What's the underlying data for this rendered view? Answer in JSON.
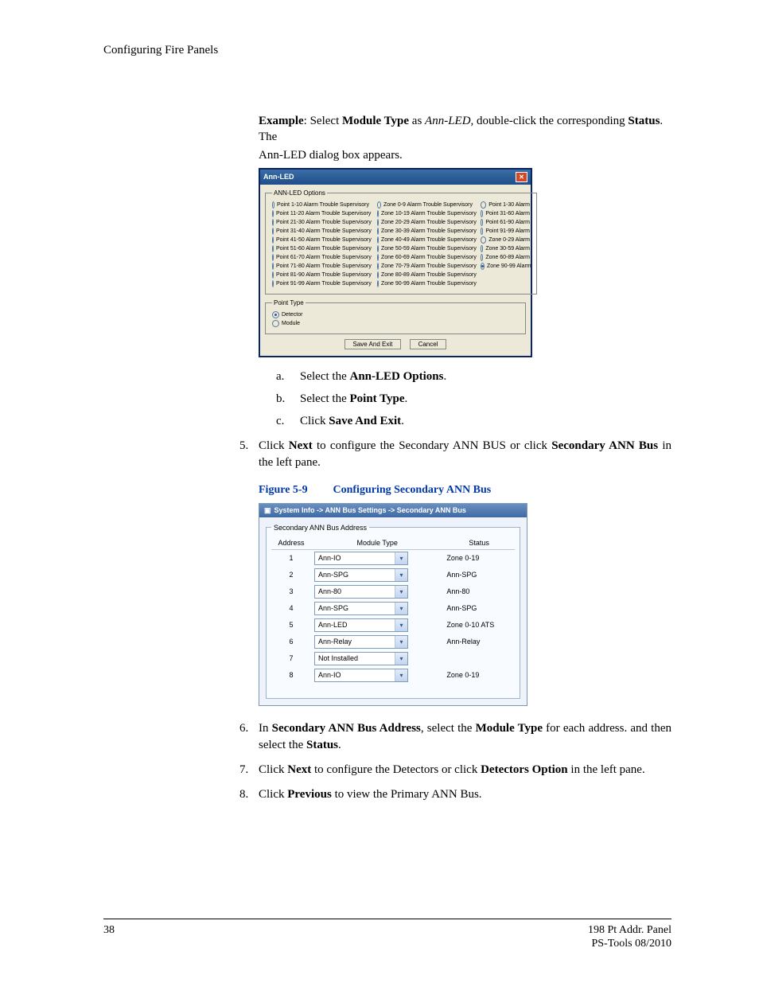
{
  "header": {
    "running": "Configuring Fire Panels"
  },
  "intro": {
    "pieces": [
      "Example",
      ": Select ",
      "Module Type",
      " as ",
      "Ann-LED,",
      " double-click the corresponding ",
      "Status",
      ". The"
    ],
    "line2": "Ann-LED dialog box appears."
  },
  "dialog": {
    "title": "Ann-LED",
    "options_legend": "ANN-LED Options",
    "col1": [
      "Point 1-10 Alarm Trouble Supervisory",
      "Point 11-20 Alarm Trouble Supervisory",
      "Point 21-30 Alarm Trouble Supervisory",
      "Point 31-40 Alarm Trouble Supervisory",
      "Point 41-50 Alarm Trouble Supervisory",
      "Point 51-60 Alarm Trouble Supervisory",
      "Point 61-70 Alarm Trouble Supervisory",
      "Point 71-80 Alarm Trouble Supervisory",
      "Point 81-90 Alarm Trouble Supervisory",
      "Point 91-99 Alarm Trouble Supervisory"
    ],
    "col2": [
      "Zone 0-9 Alarm Trouble Supervisory",
      "Zone 10-19 Alarm Trouble Supervisory",
      "Zone 20-29 Alarm Trouble Supervisory",
      "Zone 30-39 Alarm Trouble Supervisory",
      "Zone 40-49 Alarm Trouble Supervisory",
      "Zone 50-59 Alarm Trouble Supervisory",
      "Zone 60-69 Alarm Trouble Supervisory",
      "Zone 70-79 Alarm Trouble Supervisory",
      "Zone 80-89 Alarm Trouble Supervisory",
      "Zone 90-99 Alarm Trouble Supervisory"
    ],
    "col3": [
      "Point 1-30 Alarm",
      "Point 31-60 Alarm",
      "Point 61-90 Alarm",
      "Point 91-99 Alarm",
      "Zone 0-29 Alarm",
      "Zone 30-59 Alarm",
      "Zone 60-89 Alarm",
      "Zone 90-99 Alarm"
    ],
    "col3_selected_index": 7,
    "point_type_legend": "Point Type",
    "point_type": {
      "detector": "Detector",
      "module": "Module",
      "detector_selected": true
    },
    "save_btn": "Save And Exit",
    "cancel_btn": "Cancel"
  },
  "substeps": [
    {
      "m": "a.",
      "pre": "Select the ",
      "bold": "Ann-LED Options",
      "post": "."
    },
    {
      "m": "b.",
      "pre": "Select the ",
      "bold": "Point Type",
      "post": "."
    },
    {
      "m": "c.",
      "pre": "Click ",
      "bold": "Save And Exit",
      "post": "."
    }
  ],
  "steps": {
    "s5": {
      "m": "5.",
      "t1": "Click ",
      "b1": "Next",
      "t2": " to configure the Secondary ANN BUS or click ",
      "b2": "Secondary ANN Bus",
      "t3": " in the left pane."
    },
    "s6": {
      "m": "6.",
      "t1": "In ",
      "b1": "Secondary ANN Bus Address",
      "t2": ", select the ",
      "b2": "Module Type",
      "t3": " for each address. and then select the ",
      "b3": "Status",
      "t4": "."
    },
    "s7": {
      "m": "7.",
      "t1": "Click ",
      "b1": "Next",
      "t2": " to configure the Detectors or click ",
      "b2": "Detectors Option",
      "t3": " in the left pane."
    },
    "s8": {
      "m": "8.",
      "t1": "Click ",
      "b1": "Previous",
      "t2": " to view the Primary ANN Bus."
    }
  },
  "figure": {
    "num": "Figure 5-9",
    "title": "Configuring Secondary ANN Bus"
  },
  "app": {
    "breadcrumb": "System Info -> ANN Bus Settings -> Secondary ANN Bus",
    "fieldset": "Secondary ANN Bus Address",
    "headers": {
      "address": "Address",
      "module": "Module Type",
      "status": "Status"
    },
    "rows": [
      {
        "addr": "1",
        "module": "Ann-IO",
        "status": "Zone 0-19"
      },
      {
        "addr": "2",
        "module": "Ann-SPG",
        "status": "Ann-SPG"
      },
      {
        "addr": "3",
        "module": "Ann-80",
        "status": "Ann-80"
      },
      {
        "addr": "4",
        "module": "Ann-SPG",
        "status": "Ann-SPG"
      },
      {
        "addr": "5",
        "module": "Ann-LED",
        "status": "Zone 0-10 ATS"
      },
      {
        "addr": "6",
        "module": "Ann-Relay",
        "status": "Ann-Relay"
      },
      {
        "addr": "7",
        "module": "Not Installed",
        "status": ""
      },
      {
        "addr": "8",
        "module": "Ann-IO",
        "status": "Zone 0-19"
      }
    ]
  },
  "footer": {
    "page": "38",
    "right1": "198 Pt Addr. Panel",
    "right2": "PS-Tools  08/2010"
  }
}
